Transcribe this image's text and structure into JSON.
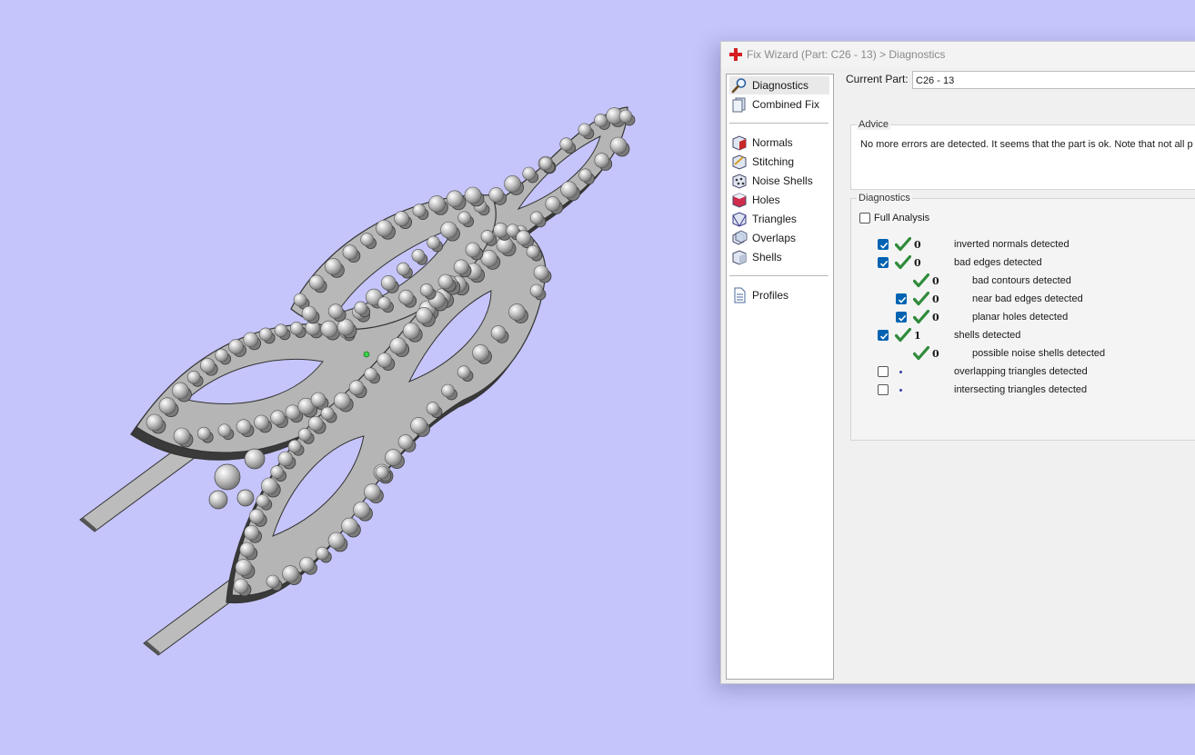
{
  "window": {
    "title": "Fix Wizard (Part: C26 - 13) > Diagnostics"
  },
  "nav": {
    "items": [
      {
        "label": "Diagnostics",
        "icon": "magnifier-icon"
      },
      {
        "label": "Combined Fix",
        "icon": "combined-fix-icon"
      },
      {
        "label": "Normals",
        "icon": "normals-icon"
      },
      {
        "label": "Stitching",
        "icon": "stitching-icon"
      },
      {
        "label": "Noise Shells",
        "icon": "noise-shells-icon"
      },
      {
        "label": "Holes",
        "icon": "holes-icon"
      },
      {
        "label": "Triangles",
        "icon": "triangles-icon"
      },
      {
        "label": "Overlaps",
        "icon": "overlaps-icon"
      },
      {
        "label": "Shells",
        "icon": "shells-icon"
      },
      {
        "label": "Profiles",
        "icon": "document-icon"
      }
    ],
    "selected": "Diagnostics"
  },
  "main": {
    "current_part_label": "Current Part:",
    "current_part_value": "C26 - 13",
    "advice_title": "Advice",
    "advice_text": "No more errors are detected. It seems that the part is ok. Note that not all p",
    "diagnostics_title": "Diagnostics",
    "full_analysis_label": "Full Analysis",
    "full_analysis_checked": false,
    "rows": [
      {
        "checkbox": true,
        "checked": true,
        "status": "ok",
        "count": "0",
        "label": "inverted normals detected"
      },
      {
        "checkbox": true,
        "checked": true,
        "status": "ok",
        "count": "0",
        "label": "bad edges detected"
      },
      {
        "checkbox": false,
        "status": "ok",
        "count": "0",
        "label": "bad contours detected"
      },
      {
        "checkbox": true,
        "checked": true,
        "status": "ok",
        "count": "0",
        "label": "near bad edges detected"
      },
      {
        "checkbox": true,
        "checked": true,
        "status": "ok",
        "count": "0",
        "label": "planar holes detected"
      },
      {
        "checkbox": true,
        "checked": true,
        "status": "ok",
        "count": "1",
        "label": "shells detected"
      },
      {
        "checkbox": false,
        "status": "ok",
        "count": "0",
        "label": "possible noise shells detected"
      },
      {
        "checkbox": true,
        "checked": false,
        "status": "not-run",
        "count": "",
        "label": "overlapping triangles detected"
      },
      {
        "checkbox": true,
        "checked": false,
        "status": "not-run",
        "count": "",
        "label": "intersecting triangles detected"
      }
    ]
  },
  "colors": {
    "viewport_background": "#c5c5fb",
    "check_green": "#2e8b3a",
    "checkbox_blue": "#0063b1",
    "logo_red": "#d42020"
  }
}
